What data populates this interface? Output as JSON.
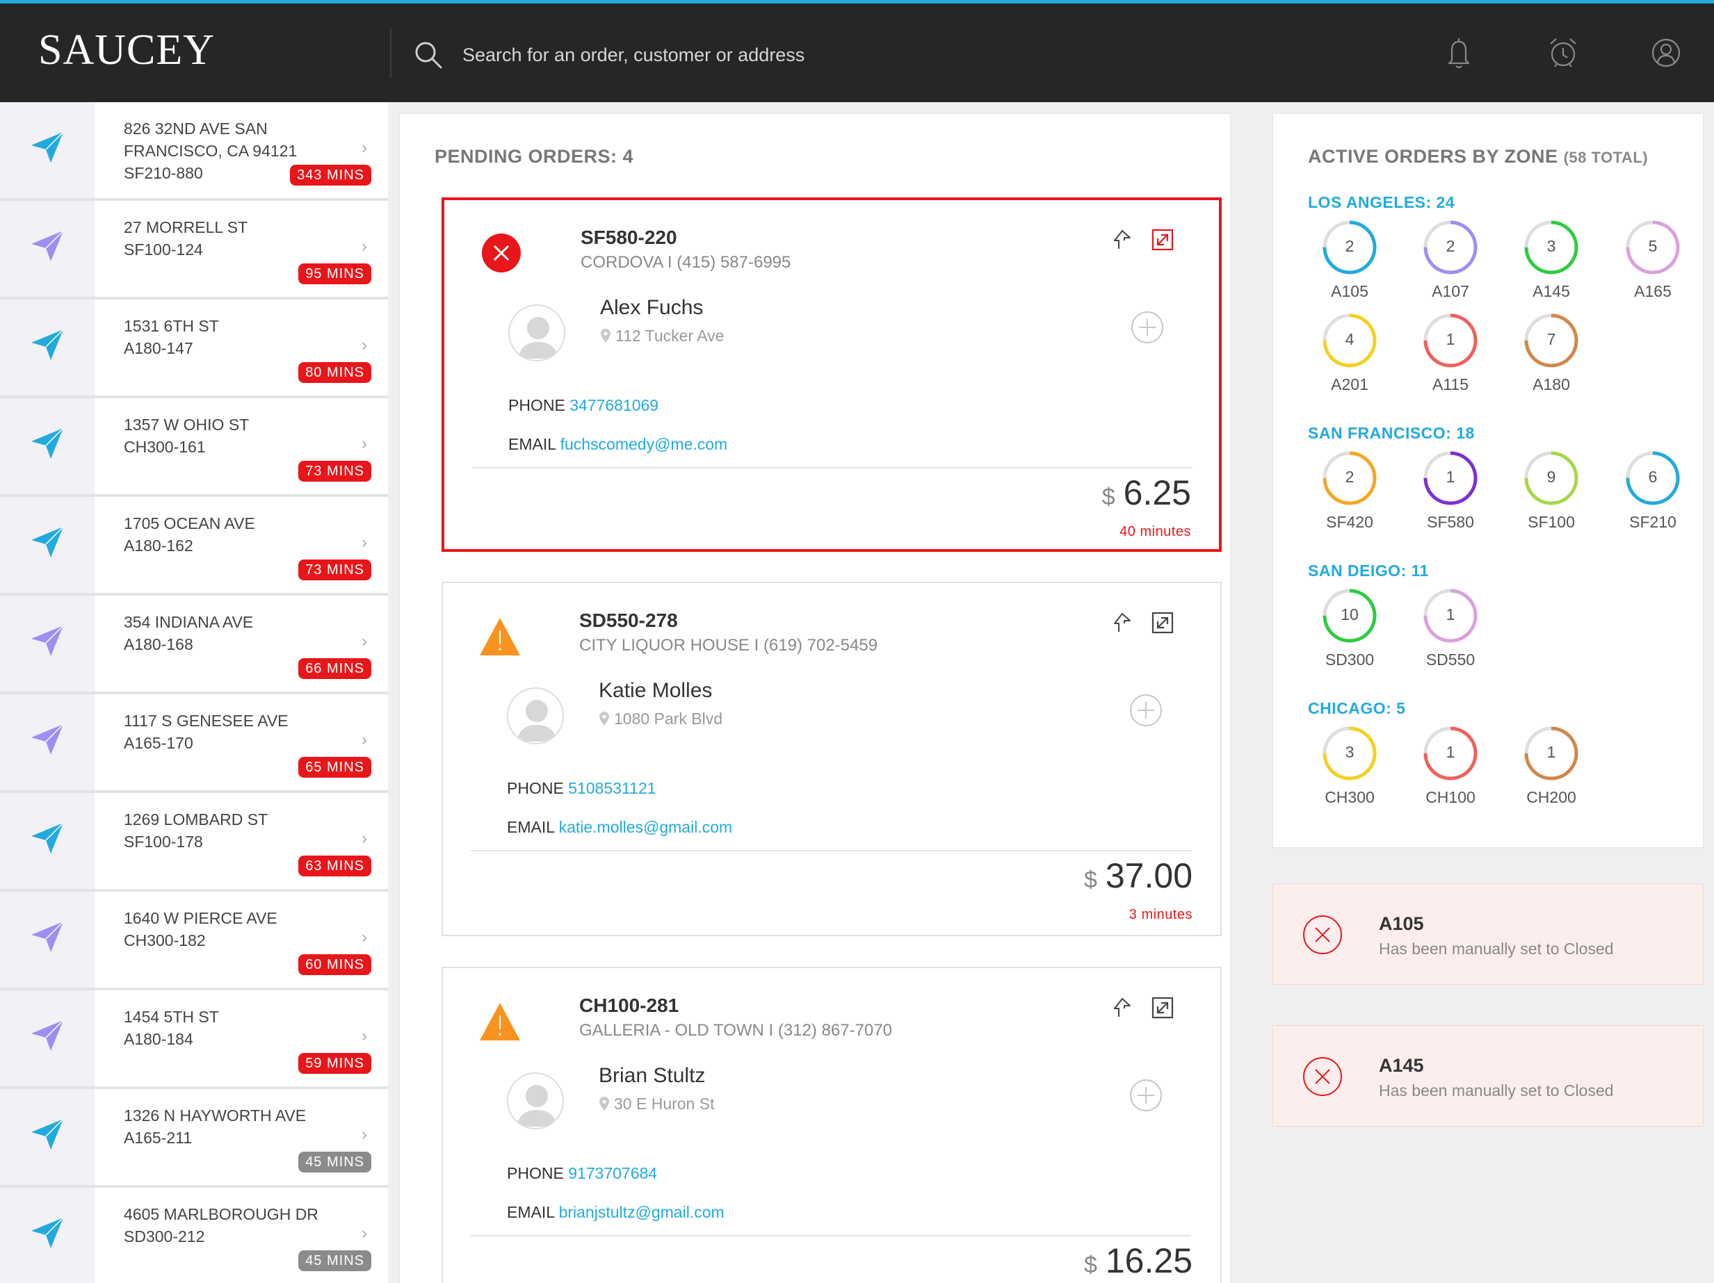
{
  "app": {
    "brand": "SAUCEY"
  },
  "header": {
    "search_placeholder": "Search for an order, customer or address",
    "icons": [
      "search-icon",
      "bell-icon",
      "alarm-clock-icon",
      "user-icon"
    ]
  },
  "colors": {
    "accent": "#22aadd",
    "alert_red": "#e8161a",
    "warning_orange": "#f7931e",
    "header_bg": "#262626"
  },
  "sidebar": {
    "items": [
      {
        "line1": "826 32ND AVE SAN",
        "line2": "FRANCISCO, CA 94121",
        "line3": "SF210-880",
        "badge": "343 MINS",
        "icon_color": "#22aadd",
        "badge_style": "red"
      },
      {
        "line1": "27 MORRELL ST",
        "line2": "SF100-124",
        "line3": "",
        "badge": "95 MINS",
        "icon_color": "#9d8ff2",
        "badge_style": "red"
      },
      {
        "line1": "1531 6TH ST",
        "line2": "A180-147",
        "line3": "",
        "badge": "80 MINS",
        "icon_color": "#22aadd",
        "badge_style": "red"
      },
      {
        "line1": "1357 W OHIO ST",
        "line2": "CH300-161",
        "line3": "",
        "badge": "73 MINS",
        "icon_color": "#22aadd",
        "badge_style": "red"
      },
      {
        "line1": "1705 OCEAN AVE",
        "line2": "A180-162",
        "line3": "",
        "badge": "73 MINS",
        "icon_color": "#22aadd",
        "badge_style": "red"
      },
      {
        "line1": "354 INDIANA AVE",
        "line2": "A180-168",
        "line3": "",
        "badge": "66 MINS",
        "icon_color": "#9d8ff2",
        "badge_style": "red"
      },
      {
        "line1": "1117 S GENESEE AVE",
        "line2": "A165-170",
        "line3": "",
        "badge": "65 MINS",
        "icon_color": "#9d8ff2",
        "badge_style": "red"
      },
      {
        "line1": "1269 LOMBARD ST",
        "line2": "SF100-178",
        "line3": "",
        "badge": "63 MINS",
        "icon_color": "#22aadd",
        "badge_style": "red"
      },
      {
        "line1": "1640 W PIERCE AVE",
        "line2": "CH300-182",
        "line3": "",
        "badge": "60 MINS",
        "icon_color": "#9d8ff2",
        "badge_style": "red"
      },
      {
        "line1": "1454 5TH ST",
        "line2": "A180-184",
        "line3": "",
        "badge": "59 MINS",
        "icon_color": "#9d8ff2",
        "badge_style": "red"
      },
      {
        "line1": "1326 N HAYWORTH AVE",
        "line2": "A165-211",
        "line3": "",
        "badge": "45 MINS",
        "icon_color": "#22aadd",
        "badge_style": "grey"
      },
      {
        "line1": "4605 MARLBOROUGH DR",
        "line2": "SD300-212",
        "line3": "",
        "badge": "45 MINS",
        "icon_color": "#22aadd",
        "badge_style": "grey"
      }
    ]
  },
  "pending": {
    "title": "PENDING ORDERS: 4",
    "orders": [
      {
        "id": "SF580-220",
        "sub": "CORDOVA I (415) 587-6995",
        "status": "error",
        "customer": "Alex Fuchs",
        "address": "112 Tucker Ave",
        "phone_label": "PHONE",
        "phone": "3477681069",
        "email_label": "EMAIL",
        "email": "fuchscomedy@me.com",
        "currency": "$",
        "price": "6.25",
        "time": "40 minutes",
        "selected": true
      },
      {
        "id": "SD550-278",
        "sub": "CITY LIQUOR HOUSE I (619) 702-5459",
        "status": "warning",
        "customer": "Katie Molles",
        "address": "1080 Park Blvd",
        "phone_label": "PHONE",
        "phone": "5108531121",
        "email_label": "EMAIL",
        "email": "katie.molles@gmail.com",
        "currency": "$",
        "price": "37.00",
        "time": "3 minutes",
        "selected": false
      },
      {
        "id": "CH100-281",
        "sub": "GALLERIA - OLD TOWN I (312) 867-7070",
        "status": "warning",
        "customer": "Brian Stultz",
        "address": "30 E Huron St",
        "phone_label": "PHONE",
        "phone": "9173707684",
        "email_label": "EMAIL",
        "email": "brianjstultz@gmail.com",
        "currency": "$",
        "price": "16.25",
        "time": "",
        "selected": false
      }
    ]
  },
  "zones": {
    "title": "ACTIVE ORDERS BY ZONE",
    "total": "(58 TOTAL)",
    "cities": [
      {
        "label": "LOS ANGELES: 24",
        "zones": [
          {
            "name": "A105",
            "count": "2",
            "color": "#22aadd",
            "fill": 0.75
          },
          {
            "name": "A107",
            "count": "2",
            "color": "#9d8ff2",
            "fill": 0.75
          },
          {
            "name": "A145",
            "count": "3",
            "color": "#2ecc40",
            "fill": 0.75
          },
          {
            "name": "A165",
            "count": "5",
            "color": "#dba0dc",
            "fill": 0.75
          },
          {
            "name": "A201",
            "count": "4",
            "color": "#f5d020",
            "fill": 0.75
          },
          {
            "name": "A115",
            "count": "1",
            "color": "#f0605a",
            "fill": 0.75
          },
          {
            "name": "A180",
            "count": "7",
            "color": "#d0874a",
            "fill": 0.75
          }
        ]
      },
      {
        "label": "SAN FRANCISCO: 18",
        "zones": [
          {
            "name": "SF420",
            "count": "2",
            "color": "#f6a623",
            "fill": 0.75
          },
          {
            "name": "SF580",
            "count": "1",
            "color": "#7d2fd0",
            "fill": 0.75
          },
          {
            "name": "SF100",
            "count": "9",
            "color": "#a6d84a",
            "fill": 0.75
          },
          {
            "name": "SF210",
            "count": "6",
            "color": "#22aadd",
            "fill": 0.75
          }
        ]
      },
      {
        "label": "SAN DEIGO: 11",
        "zones": [
          {
            "name": "SD300",
            "count": "10",
            "color": "#2ecc40",
            "fill": 0.75
          },
          {
            "name": "SD550",
            "count": "1",
            "color": "#dba0dc",
            "fill": 0.75
          }
        ]
      },
      {
        "label": "CHICAGO: 5",
        "zones": [
          {
            "name": "CH300",
            "count": "3",
            "color": "#f5d020",
            "fill": 0.75
          },
          {
            "name": "CH100",
            "count": "1",
            "color": "#f0605a",
            "fill": 0.75
          },
          {
            "name": "CH200",
            "count": "1",
            "color": "#d0874a",
            "fill": 0.75
          }
        ]
      }
    ]
  },
  "notifications": [
    {
      "title": "A105",
      "message": "Has been manually set to Closed"
    },
    {
      "title": "A145",
      "message": "Has been manually set to Closed"
    }
  ]
}
